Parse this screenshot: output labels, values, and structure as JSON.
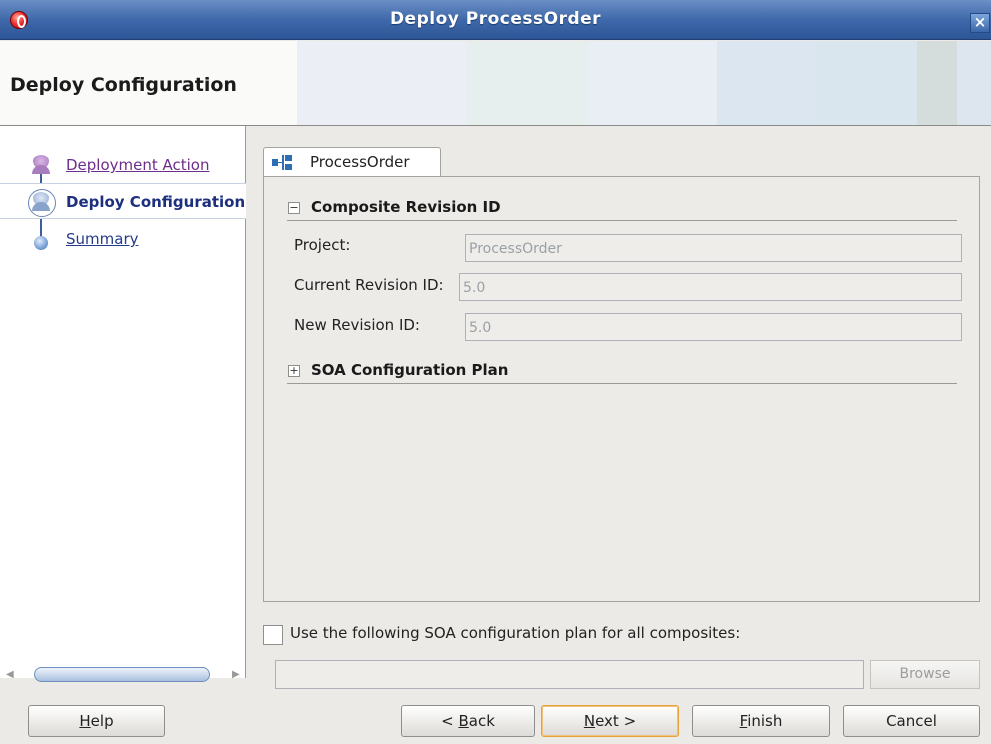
{
  "window": {
    "title": "Deploy ProcessOrder",
    "close_glyph": "×"
  },
  "header": {
    "heading": "Deploy Configuration"
  },
  "nav": {
    "items": [
      {
        "label": "Deployment Action",
        "state": "visited"
      },
      {
        "label": "Deploy Configuration",
        "state": "current"
      },
      {
        "label": "Summary",
        "state": "pending"
      }
    ]
  },
  "tab": {
    "label": "ProcessOrder",
    "icon": "composite-icon"
  },
  "sections": {
    "composite_revision": {
      "toggle": "−",
      "label": "Composite Revision ID",
      "expanded": true
    },
    "soa_plan": {
      "toggle": "+",
      "label": "SOA Configuration Plan",
      "expanded": false
    }
  },
  "fields": {
    "project": {
      "label": "Project:",
      "value": "ProcessOrder"
    },
    "current_revision": {
      "label": "Current Revision ID:",
      "value": "5.0"
    },
    "new_revision": {
      "label": "New Revision ID:",
      "value": "5.0"
    }
  },
  "plan_option": {
    "label": "Use the following SOA configuration plan for all composites:",
    "checked": false,
    "path": "",
    "browse_label": "Browse"
  },
  "buttons": {
    "help": {
      "mnemonic": "H",
      "rest": "elp"
    },
    "back": {
      "prefix": "< ",
      "mnemonic": "B",
      "rest": "ack"
    },
    "next": {
      "mnemonic": "N",
      "rest": "ext >"
    },
    "finish": {
      "mnemonic": "F",
      "rest": "inish"
    },
    "cancel": {
      "label": "Cancel"
    }
  },
  "colors": {
    "title_bar": "#3f69aa",
    "link_visited": "#6d2d8a",
    "current_step": "#1d2f7d",
    "default_button_border": "#e8a23c"
  }
}
